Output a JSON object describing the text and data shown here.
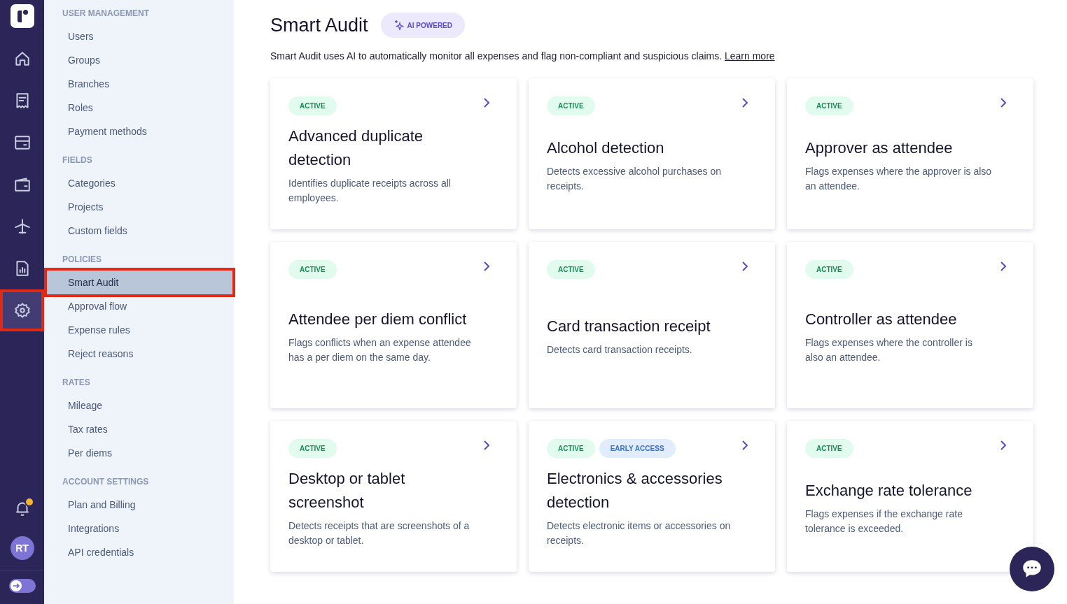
{
  "rail": {
    "items": [
      {
        "kind": "home",
        "selected": false
      },
      {
        "kind": "receipt",
        "selected": false
      },
      {
        "kind": "card",
        "selected": false
      },
      {
        "kind": "wallet",
        "selected": false
      },
      {
        "kind": "plane",
        "selected": false
      },
      {
        "kind": "report",
        "selected": false
      },
      {
        "kind": "settings",
        "selected": true
      }
    ],
    "notifications_unread": true,
    "avatar": "RT",
    "expanded": false
  },
  "sidebar": {
    "sections": [
      {
        "heading": "USER MANAGEMENT",
        "items": [
          {
            "label": "Users",
            "selected": false
          },
          {
            "label": "Groups",
            "selected": false
          },
          {
            "label": "Branches",
            "selected": false
          },
          {
            "label": "Roles",
            "selected": false
          },
          {
            "label": "Payment methods",
            "selected": false
          }
        ]
      },
      {
        "heading": "FIELDS",
        "items": [
          {
            "label": "Categories",
            "selected": false
          },
          {
            "label": "Projects",
            "selected": false
          },
          {
            "label": "Custom fields",
            "selected": false
          }
        ]
      },
      {
        "heading": "POLICIES",
        "items": [
          {
            "label": "Smart Audit",
            "selected": true
          },
          {
            "label": "Approval flow",
            "selected": false
          },
          {
            "label": "Expense rules",
            "selected": false
          },
          {
            "label": "Reject reasons",
            "selected": false
          }
        ]
      },
      {
        "heading": "RATES",
        "items": [
          {
            "label": "Mileage",
            "selected": false
          },
          {
            "label": "Tax rates",
            "selected": false
          },
          {
            "label": "Per diems",
            "selected": false
          }
        ]
      },
      {
        "heading": "ACCOUNT SETTINGS",
        "items": [
          {
            "label": "Plan and Billing",
            "selected": false
          },
          {
            "label": "Integrations",
            "selected": false
          },
          {
            "label": "API credentials",
            "selected": false
          }
        ]
      }
    ]
  },
  "page": {
    "title": "Smart Audit",
    "badge": "AI POWERED",
    "description": "Smart Audit uses AI to automatically monitor all expenses and flag non-compliant and suspicious claims.",
    "link": "Learn more"
  },
  "cards": [
    {
      "badges": [
        {
          "kind": "active",
          "text": "ACTIVE"
        }
      ],
      "title": "Advanced duplicate detection",
      "description": "Identifies duplicate receipts across all employees."
    },
    {
      "badges": [
        {
          "kind": "active",
          "text": "ACTIVE"
        }
      ],
      "title": "Alcohol detection",
      "description": "Detects excessive alcohol purchases on receipts."
    },
    {
      "badges": [
        {
          "kind": "active",
          "text": "ACTIVE"
        }
      ],
      "title": "Approver as attendee",
      "description": "Flags expenses where the approver is also an attendee."
    },
    {
      "badges": [
        {
          "kind": "active",
          "text": "ACTIVE"
        }
      ],
      "title": "Attendee per diem conflict",
      "description": "Flags conflicts when an expense attendee has a per diem on the same day."
    },
    {
      "badges": [
        {
          "kind": "active",
          "text": "ACTIVE"
        }
      ],
      "title": "Card transaction receipt",
      "description": "Detects card transaction receipts."
    },
    {
      "badges": [
        {
          "kind": "active",
          "text": "ACTIVE"
        }
      ],
      "title": "Controller as attendee",
      "description": "Flags expenses where the controller is also an attendee."
    },
    {
      "badges": [
        {
          "kind": "active",
          "text": "ACTIVE"
        }
      ],
      "title": "Desktop or tablet screenshot",
      "description": "Detects receipts that are screenshots of a desktop or tablet."
    },
    {
      "badges": [
        {
          "kind": "active",
          "text": "ACTIVE"
        },
        {
          "kind": "early",
          "text": "EARLY ACCESS"
        }
      ],
      "title": "Electronics & accessories detection",
      "description": "Detects electronic items or accessories on receipts."
    },
    {
      "badges": [
        {
          "kind": "active",
          "text": "ACTIVE"
        }
      ],
      "title": "Exchange rate tolerance",
      "description": "Flags expenses if the exchange rate tolerance is exceeded."
    }
  ]
}
